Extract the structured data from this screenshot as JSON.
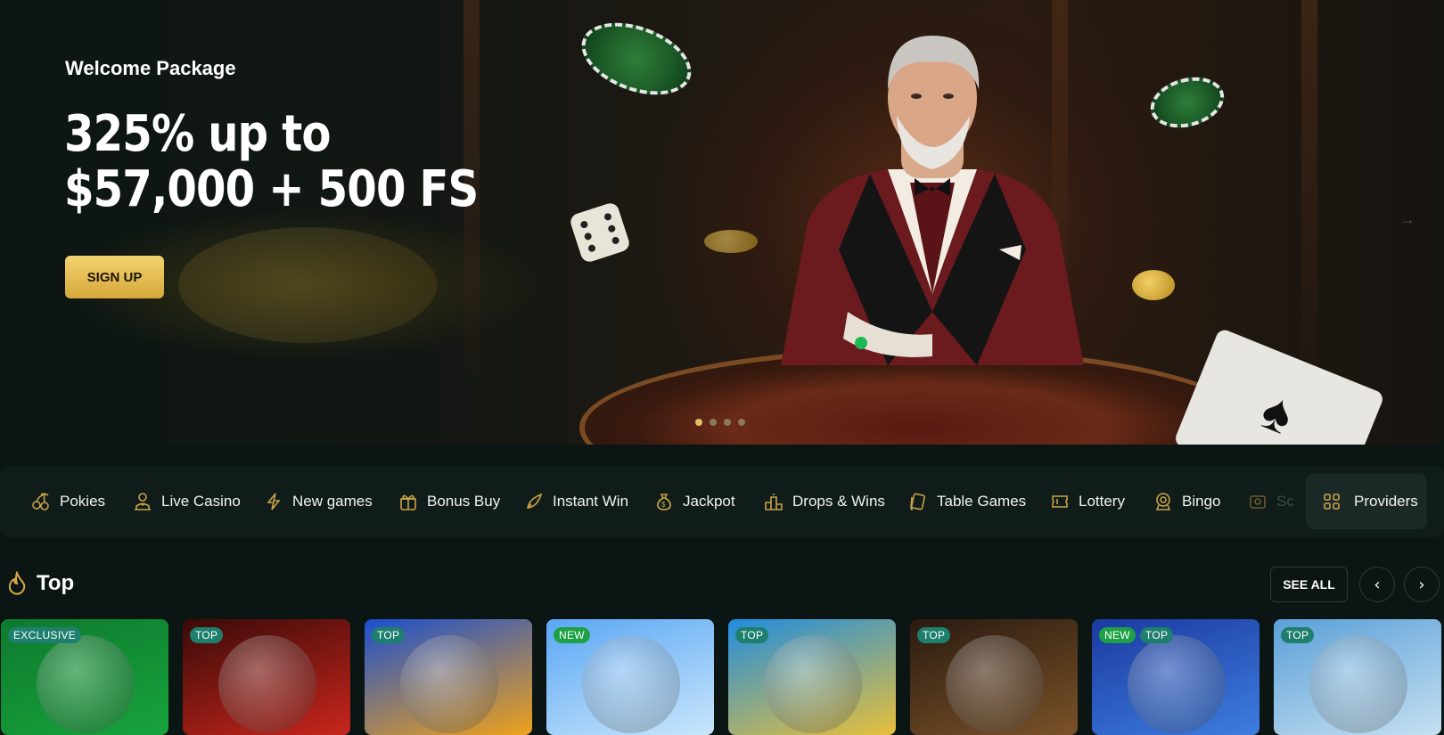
{
  "hero": {
    "subtitle": "Welcome Package",
    "headline_line1": "325% up to",
    "headline_line2": "$57,000 + 500 FS",
    "cta_label": "SIGN UP",
    "next_arrow": "→",
    "slides": 4,
    "active_slide": 1
  },
  "categories": [
    {
      "label": "Pokies",
      "icon": "cherries-icon"
    },
    {
      "label": "Live Casino",
      "icon": "dealer-icon"
    },
    {
      "label": "New games",
      "icon": "lightning-icon"
    },
    {
      "label": "Bonus Buy",
      "icon": "gift-icon"
    },
    {
      "label": "Instant Win",
      "icon": "rocket-icon"
    },
    {
      "label": "Jackpot",
      "icon": "money-bag-icon"
    },
    {
      "label": "Drops & Wins",
      "icon": "podium-icon"
    },
    {
      "label": "Table Games",
      "icon": "cards-icon"
    },
    {
      "label": "Lottery",
      "icon": "ticket-icon"
    },
    {
      "label": "Bingo",
      "icon": "bingo-ball-icon"
    },
    {
      "label": "Sc",
      "icon": "scratch-icon"
    }
  ],
  "providers_label": "Providers",
  "top_section": {
    "title": "Top",
    "see_all_label": "SEE ALL",
    "prev_arrow": "‹",
    "next_arrow": "›"
  },
  "games": [
    {
      "badges": [
        "EXCLUSIVE"
      ],
      "colors": [
        "#0e7a2e",
        "#17a33c"
      ]
    },
    {
      "badges": [
        "TOP"
      ],
      "colors": [
        "#3a0a08",
        "#c8261c"
      ]
    },
    {
      "badges": [
        "TOP"
      ],
      "colors": [
        "#1a4fd0",
        "#f0a21a"
      ]
    },
    {
      "badges": [
        "NEW"
      ],
      "colors": [
        "#5aa7f5",
        "#c9e6fb"
      ]
    },
    {
      "badges": [
        "TOP"
      ],
      "colors": [
        "#1f8de0",
        "#e8c03a"
      ]
    },
    {
      "badges": [
        "TOP"
      ],
      "colors": [
        "#2a1a10",
        "#7a5228"
      ]
    },
    {
      "badges": [
        "NEW",
        "TOP"
      ],
      "colors": [
        "#1a3aa0",
        "#3e7de0"
      ]
    },
    {
      "badges": [
        "TOP"
      ],
      "colors": [
        "#5aa0d8",
        "#c6e0f2"
      ]
    }
  ],
  "colors": {
    "background": "#0b1513",
    "accent_gold": "#d6a83a",
    "badge_teal": "#1e7f6e",
    "badge_green": "#1ea046"
  }
}
